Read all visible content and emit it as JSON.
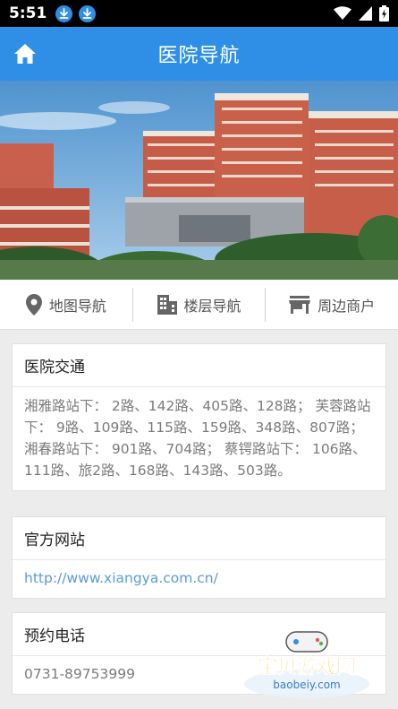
{
  "status_bar": {
    "time": "5:51"
  },
  "header": {
    "title": "医院导航"
  },
  "nav": {
    "items": [
      {
        "label": "地图导航",
        "icon": "map-pin-icon"
      },
      {
        "label": "楼层导航",
        "icon": "building-icon"
      },
      {
        "label": "周边商户",
        "icon": "store-icon"
      }
    ]
  },
  "cards": {
    "transport": {
      "title": "医院交通",
      "body": "湘雅路站下： 2路、142路、405路、128路； 芙蓉路站下： 9路、109路、115路、159路、348路、807路； 湘春路站下： 901路、704路； 蔡锷路站下： 106路、111路、旅2路、168路、143路、503路。"
    },
    "website": {
      "title": "官方网站",
      "url": "http://www.xiangya.com.cn/"
    },
    "phone": {
      "title": "预约电话",
      "number": "0731-89753999"
    }
  },
  "watermark": {
    "brand": "宝贝游戏网",
    "domain": "baobeiy.com"
  },
  "colors": {
    "primary": "#2f8fe6",
    "link": "#5a9bd5"
  }
}
